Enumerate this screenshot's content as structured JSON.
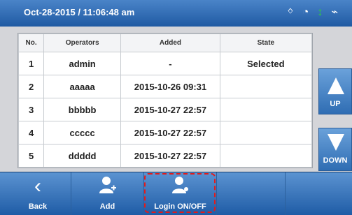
{
  "status": {
    "datetime": "Oct-28-2015 / 11:06:48 am",
    "icons": [
      "bluetooth-icon",
      "wifi-icon",
      "thermometer-icon",
      "plug-icon"
    ]
  },
  "table": {
    "headers": [
      "No.",
      "Operators",
      "Added",
      "State"
    ],
    "rows": [
      {
        "no": "1",
        "operator": "admin",
        "added": "-",
        "state": "Selected"
      },
      {
        "no": "2",
        "operator": "aaaaa",
        "added": "2015-10-26 09:31",
        "state": ""
      },
      {
        "no": "3",
        "operator": "bbbbb",
        "added": "2015-10-27 22:57",
        "state": ""
      },
      {
        "no": "4",
        "operator": "ccccc",
        "added": "2015-10-27 22:57",
        "state": ""
      },
      {
        "no": "5",
        "operator": "ddddd",
        "added": "2015-10-27 22:57",
        "state": ""
      }
    ]
  },
  "side": {
    "up_label": "UP",
    "down_label": "DOWN"
  },
  "toolbar": {
    "back_label": "Back",
    "add_label": "Add",
    "login_label": "Login ON/OFF"
  },
  "colors": {
    "accent": "#2f6db3",
    "highlight": "#e11b1b"
  }
}
